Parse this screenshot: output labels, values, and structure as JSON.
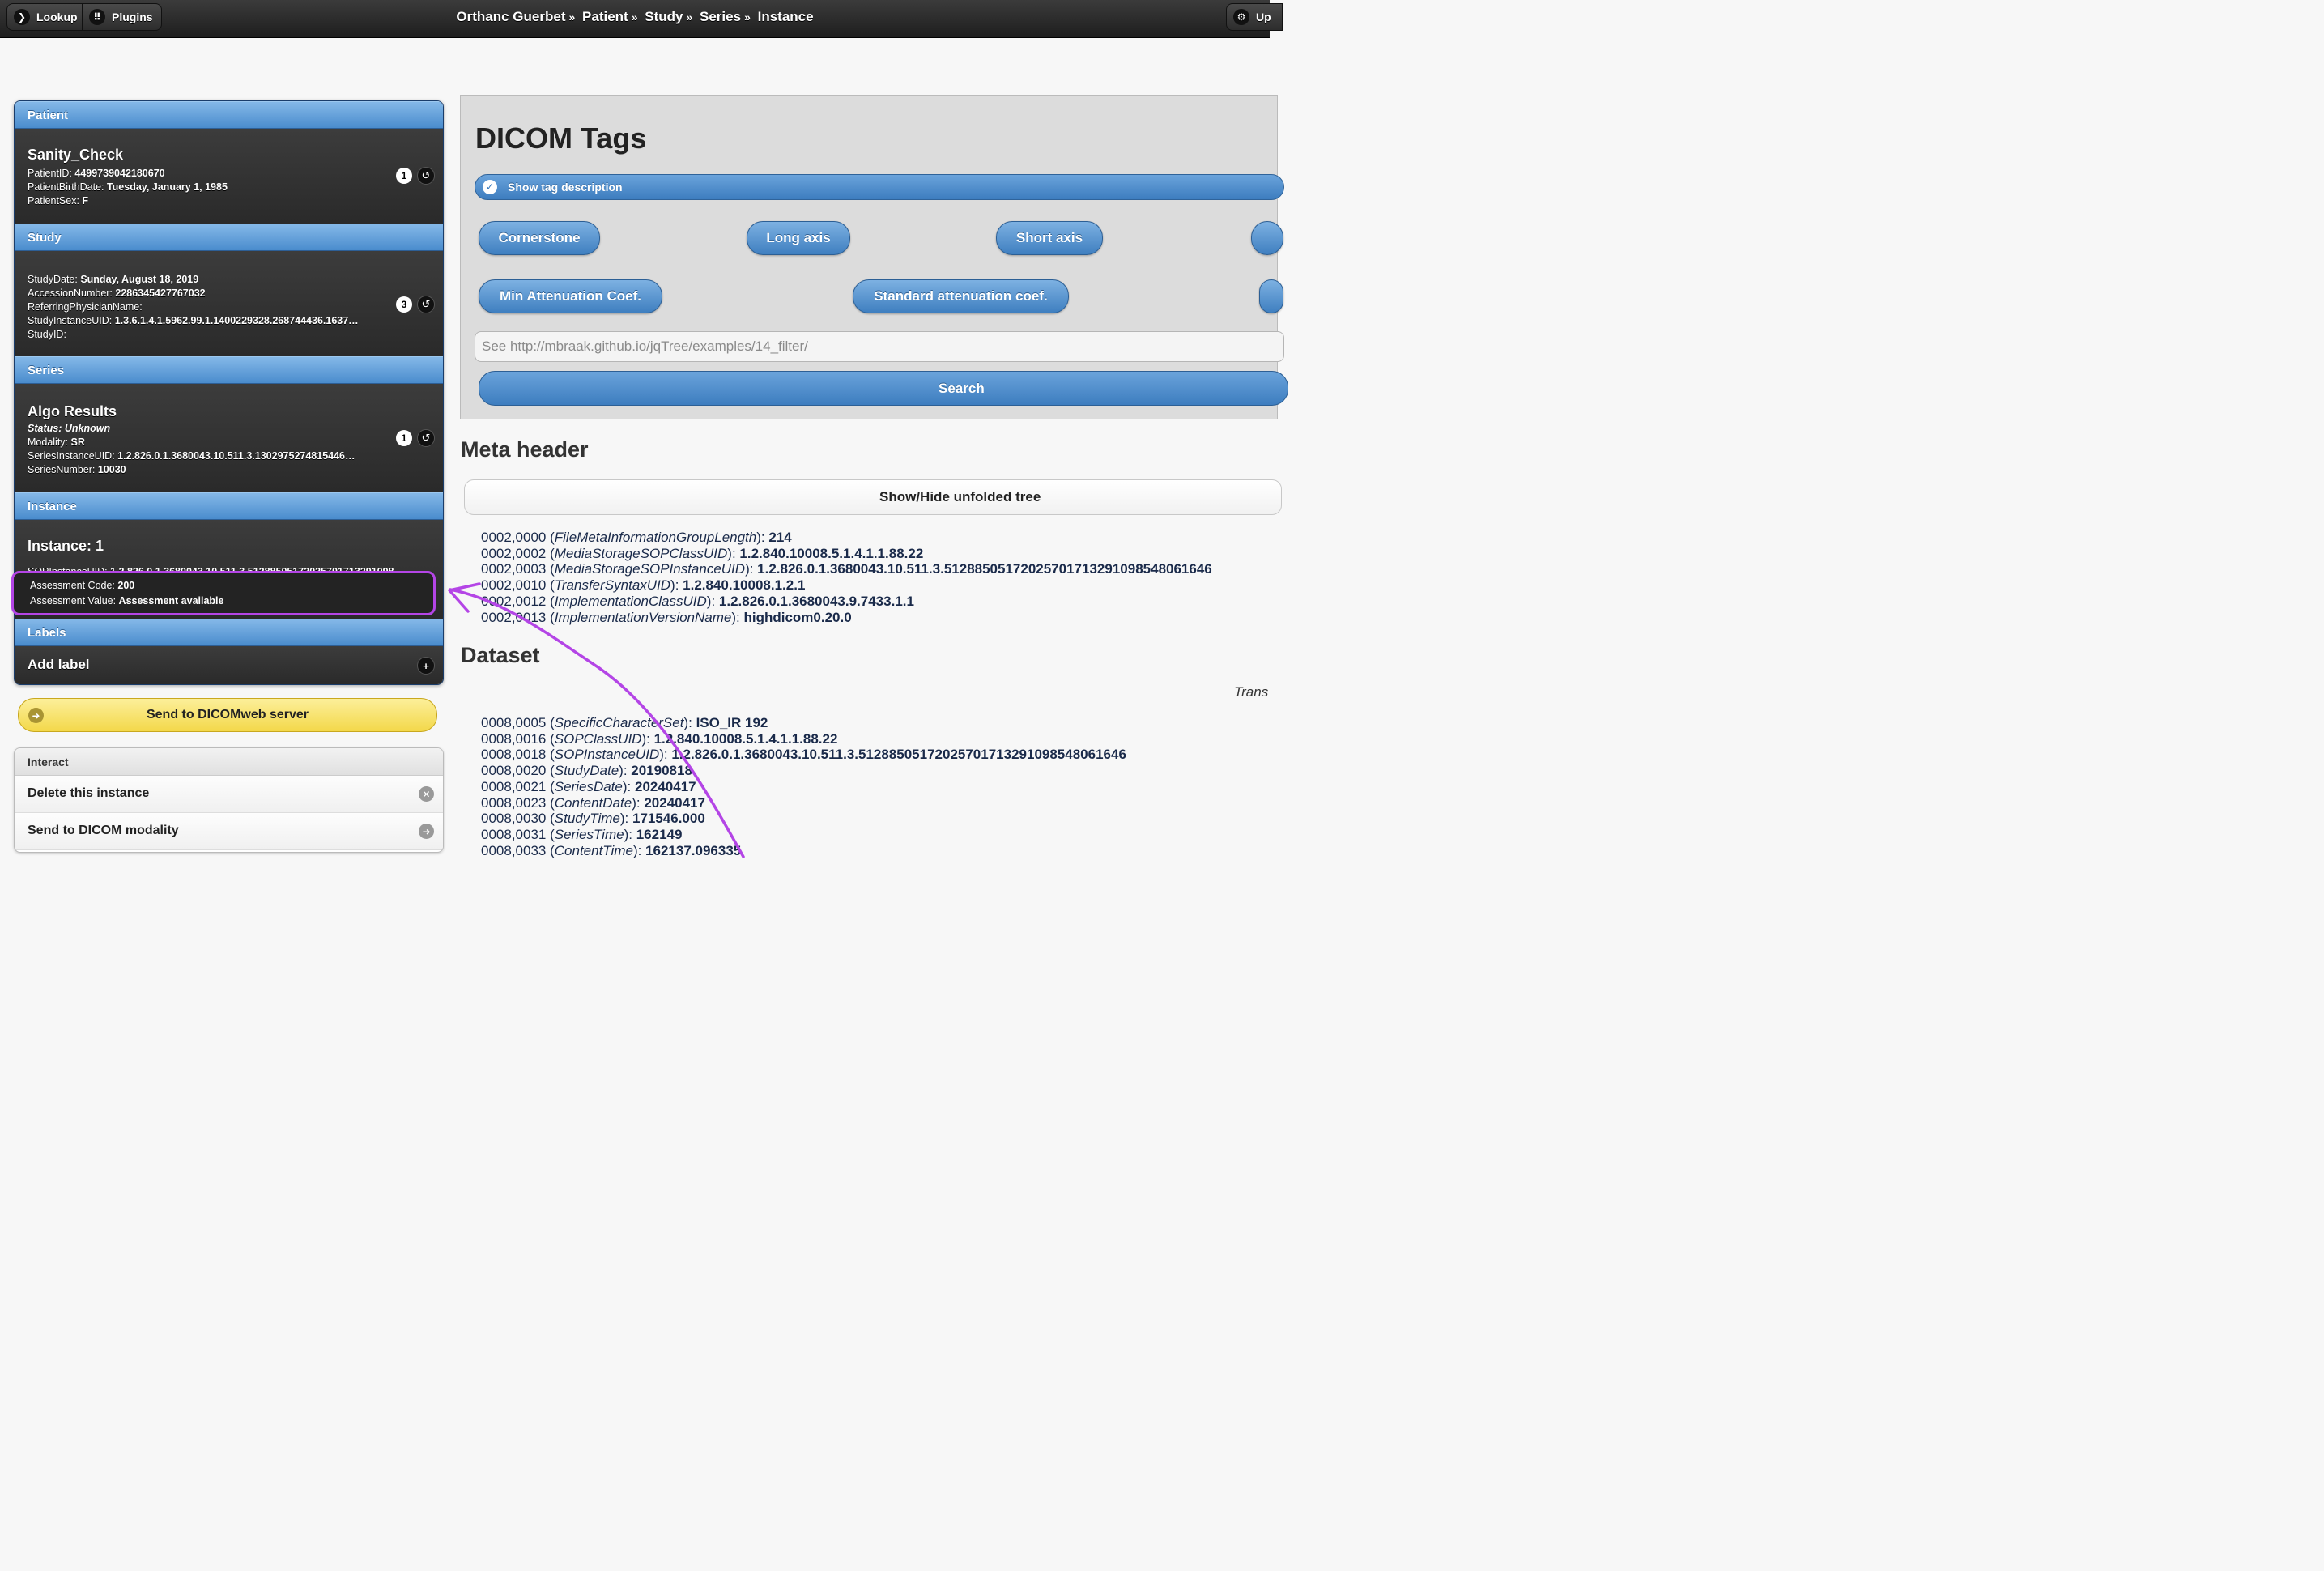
{
  "topbar": {
    "lookup_label": "Lookup",
    "plugins_label": "Plugins",
    "upload_label": "Up",
    "breadcrumb": [
      "Orthanc Guerbet",
      "Patient",
      "Study",
      "Series",
      "Instance"
    ],
    "separator": "»"
  },
  "patient": {
    "header": "Patient",
    "name": "Sanity_Check",
    "fields": [
      {
        "label": "PatientID: ",
        "value": "4499739042180670"
      },
      {
        "label": "PatientBirthDate: ",
        "value": "Tuesday, January 1, 1985"
      },
      {
        "label": "PatientSex: ",
        "value": "F"
      }
    ],
    "count": "1"
  },
  "study": {
    "header": "Study",
    "fields": [
      {
        "label": "StudyDate: ",
        "value": "Sunday, August 18, 2019"
      },
      {
        "label": "AccessionNumber: ",
        "value": "2286345427767032"
      },
      {
        "label": "ReferringPhysicianName: ",
        "value": ""
      },
      {
        "label": "StudyInstanceUID: ",
        "value": "1.3.6.1.4.1.5962.99.1.1400229328.268744436.1637…"
      },
      {
        "label": "StudyID: ",
        "value": ""
      }
    ],
    "count": "3"
  },
  "series": {
    "header": "Series",
    "name": "Algo Results",
    "status": "Status: Unknown",
    "fields": [
      {
        "label": "Modality: ",
        "value": "SR"
      },
      {
        "label": "SeriesInstanceUID: ",
        "value": "1.2.826.0.1.3680043.10.511.3.1302975274815446…"
      },
      {
        "label": "SeriesNumber: ",
        "value": "10030"
      }
    ],
    "count": "1"
  },
  "instance": {
    "header": "Instance",
    "name": "Instance: 1",
    "sop_label": "SOPInstanceUID: ",
    "sop_value": "1.2.826.0.1.3680043.10.511.3.51288505172025701713291098",
    "assessment": [
      {
        "label": "Assessment Code: ",
        "value": "200"
      },
      {
        "label": "Assessment Value: ",
        "value": "Assessment available"
      }
    ]
  },
  "labels": {
    "header": "Labels",
    "add_label": "Add label"
  },
  "send_dicomweb": "Send to DICOMweb server",
  "interact": {
    "header": "Interact",
    "delete": "Delete this instance",
    "send_modality": "Send to DICOM modality"
  },
  "dicom_tags": {
    "title": "DICOM Tags",
    "toggle_label": "Show tag description",
    "tools": [
      "Cornerstone",
      "Long axis",
      "Short axis",
      "Min Attenuation Coef.",
      "Standard attenuation coef."
    ],
    "filter_placeholder": "See http://mbraak.github.io/jqTree/examples/14_filter/",
    "search_label": "Search"
  },
  "meta_header": {
    "title": "Meta header",
    "unfold_label": "Show/Hide unfolded tree",
    "tags": [
      {
        "code": "0002,0000",
        "name": "FileMetaInformationGroupLength",
        "value": "214"
      },
      {
        "code": "0002,0002",
        "name": "MediaStorageSOPClassUID",
        "value": "1.2.840.10008.5.1.4.1.1.88.22"
      },
      {
        "code": "0002,0003",
        "name": "MediaStorageSOPInstanceUID",
        "value": "1.2.826.0.1.3680043.10.511.3.51288505172025701713291098548061646"
      },
      {
        "code": "0002,0010",
        "name": "TransferSyntaxUID",
        "value": "1.2.840.10008.1.2.1"
      },
      {
        "code": "0002,0012",
        "name": "ImplementationClassUID",
        "value": "1.2.826.0.1.3680043.9.7433.1.1"
      },
      {
        "code": "0002,0013",
        "name": "ImplementationVersionName",
        "value": "highdicom0.20.0"
      }
    ]
  },
  "dataset": {
    "title": "Dataset",
    "trans_label": "Trans",
    "tags": [
      {
        "code": "0008,0005",
        "name": "SpecificCharacterSet",
        "value": "ISO_IR 192"
      },
      {
        "code": "0008,0016",
        "name": "SOPClassUID",
        "value": "1.2.840.10008.5.1.4.1.1.88.22"
      },
      {
        "code": "0008,0018",
        "name": "SOPInstanceUID",
        "value": "1.2.826.0.1.3680043.10.511.3.51288505172025701713291098548061646"
      },
      {
        "code": "0008,0020",
        "name": "StudyDate",
        "value": "20190818"
      },
      {
        "code": "0008,0021",
        "name": "SeriesDate",
        "value": "20240417"
      },
      {
        "code": "0008,0023",
        "name": "ContentDate",
        "value": "20240417"
      },
      {
        "code": "0008,0030",
        "name": "StudyTime",
        "value": "171546.000"
      },
      {
        "code": "0008,0031",
        "name": "SeriesTime",
        "value": "162149"
      },
      {
        "code": "0008,0033",
        "name": "ContentTime",
        "value": "162137.096335"
      }
    ]
  },
  "colors": {
    "highlight": "#b445e6",
    "header_blue": "#4a8ccd",
    "send_yellow": "#f3d84a"
  }
}
